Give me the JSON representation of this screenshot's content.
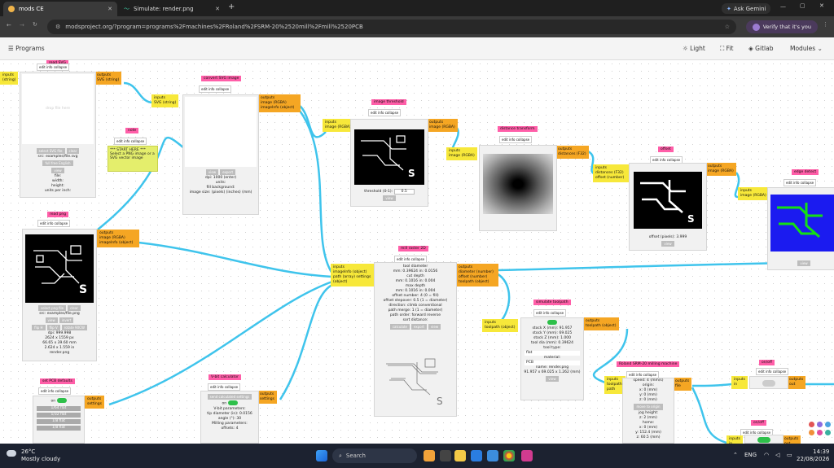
{
  "browser": {
    "tabs": [
      {
        "label": "mods CE",
        "active": true
      },
      {
        "label": "Simulate: render.png",
        "active": false
      }
    ],
    "new_tab_symbol": "+",
    "ask_button": "Ask Gemini",
    "url": "modsproject.org/?program=programs%2Fmachines%2FRoland%2FSRM-20%2520mill%2Fmill%2520PCB",
    "verify_label": "Verify that it's you"
  },
  "app": {
    "programs_label": "Programs",
    "light_label": "Light",
    "fit_label": "Fit",
    "gitlab_label": "Gitlab",
    "modules_label": "Modules"
  },
  "common": {
    "edit_info": "edit info collapse",
    "inputs": "inputs",
    "outputs": "outputs"
  },
  "modules": {
    "svg": {
      "title": "read SVG",
      "in_port": "(string)",
      "out_port": "SVG (string)",
      "placeholder": "drop file here",
      "select_btn": "select SVG file",
      "clear_btn": "clear",
      "src": "src: examples/file.svg",
      "view_btn": "full free English",
      "view2_btn": "view",
      "file_info": "file:",
      "width_info": "width:",
      "height_info": "height:",
      "units_info": "units per inch:"
    },
    "note": {
      "title": "note",
      "text": "*** START HERE *** Select a PNG image or a SVG vector image"
    },
    "convert": {
      "title": "convert SVG image",
      "in_port": "SVG (string)",
      "out_port": "image (RGBA) imageInfo (object)",
      "view_btn": "view",
      "export_btn": "export",
      "dpi": "dpi: 1000 (enter)",
      "units": "units:",
      "fill": "fill background:",
      "image_size": "image size: (pixels) (inches) (mm)"
    },
    "png": {
      "title": "read png",
      "out_port": "image (RGBA) imageInfo (object)",
      "select_btn": "select png file",
      "clear_btn": "clear",
      "src": "src: examples/file.png",
      "view_btn": "view",
      "invert_btn": "invert",
      "flipH_btn": "flip H",
      "flipV_btn": "flip V",
      "rotate_btn": "rotate 90CW",
      "dpi": "dpi: 999.998",
      "size1": "2624 x 1559 px",
      "size2": "66.65 x 39.60 mm",
      "size3": "2.624 x 1.559 in",
      "name": "render.png"
    },
    "threshold": {
      "title": "image threshold",
      "in_port": "image (RGBA)",
      "out_port": "image (RGBA)",
      "threshold_label": "threshold (0-1):",
      "threshold_value": "0.5",
      "view_btn": "view"
    },
    "distance": {
      "title": "distance transform",
      "in_port": "image (RGBA)",
      "out_port": "distances (F32)"
    },
    "offset": {
      "title": "offset",
      "in_port": "distances (F32) offset (number)",
      "out_port": "image (RGBA)",
      "offset_label": "offset (pixels):",
      "offset_value": "3.999",
      "view_btn": "view"
    },
    "edge": {
      "title": "edge detect",
      "in_port": "image (RGBA)",
      "view_btn": "view"
    },
    "raster": {
      "title": "mill raster 2D",
      "in_port": "imageInfo (object) path (array) settings (object)",
      "out_port": "diameter (number) offset (number) toolpath (object)",
      "lines": [
        "tool diameter",
        "mm: 0.39624  in: 0.0156",
        "cut depth",
        "mm: 0.1016  in: 0.004",
        "max depth",
        "mm: 0.1016  in: 0.004",
        "offset number: 4  (0 = fill)",
        "offset stepover: 0.5  (1 = diameter)",
        "direction: climb  conventional",
        "path merge: 1  (1 = diameter)",
        "path order: forward  reverse",
        "sort distance:"
      ],
      "calc_btn": "calculate",
      "export_btn": "export",
      "view_btn": "view"
    },
    "simulate": {
      "title": "simulate toolpath",
      "in_port": "toolpath (object)",
      "out_port": "toolpath (object)",
      "lines": [
        "stock X (mm): 91.957",
        "stock Y (mm): 69.025",
        "stock Z (mm): 1.000",
        "tool dia (mm): 0.39624",
        "tool type:",
        "flat",
        "material:",
        "PCB",
        "name: render.png",
        "91.957 x 69.025 x 1.262 (mm)"
      ],
      "view_btn": "view"
    },
    "roland": {
      "title": "Roland SRM-20 milling machine",
      "in_port": "toolpath path",
      "out_port": "file",
      "lines": [
        "speed: 4  (mm/s)",
        "origin:",
        "x: 0  (mm)",
        "y: 0  (mm)",
        "z: 0  (mm)",
        "move to origin",
        "jog height:",
        "z: 2  (mm)",
        "home:",
        "x: 0  (mm)",
        "y: 152.4  (mm)",
        "z: 60.5  (mm)"
      ]
    },
    "onoff1": {
      "title": "on/off",
      "in_port": "in",
      "out_port": "out"
    },
    "onoff2": {
      "title": "on/off",
      "in_port": "in",
      "out_port": "out"
    },
    "pcbdefaults": {
      "title": "set PCB defaults",
      "toggle_on": "on",
      "out_port": "settings",
      "items": [
        "1/64 flat",
        "1/32 flat",
        "1/8 flat",
        "1/8 flat"
      ]
    },
    "vbit": {
      "title": "V-bit calculator",
      "send_btn": "send calculated settings",
      "toggle_on": "on",
      "out_port": "settings",
      "lines": [
        "V-bit parameters:",
        "tip diameter (in): 0.0156",
        "angle (°): 30",
        "Milling parameters:",
        "offsets: 4"
      ]
    }
  },
  "taskbar": {
    "temp": "26°C",
    "weather": "Mostly cloudy",
    "search_placeholder": "Search",
    "time": "14:39",
    "date": "22/08/2026",
    "lang": "ENG"
  },
  "colors": {
    "title_pink": "#ff5ea8",
    "input_yellow": "#f7e83a",
    "output_orange": "#f5a623",
    "wire_blue": "#3fc4ec",
    "toggle_green": "#2ec04a"
  }
}
